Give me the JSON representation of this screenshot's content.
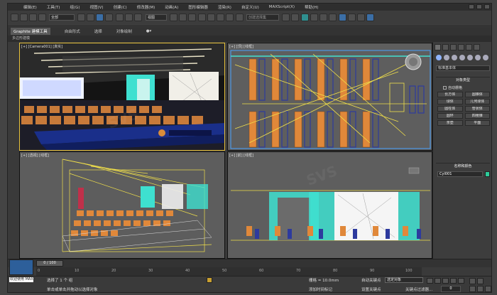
{
  "menu": {
    "items": [
      "编辑(E)",
      "工具(T)",
      "组(G)",
      "视图(V)",
      "创建(C)",
      "修改器(M)",
      "动画(A)",
      "图形编辑器",
      "渲染(R)",
      "自定义(U)",
      "MAXScript(X)",
      "帮助(H)"
    ]
  },
  "toolbar": {
    "selection_filter": "全部",
    "view_dropdown": "视图",
    "named_selection_placeholder": "创建选择集"
  },
  "ribbon": {
    "tabs": [
      "Graphite 建模工具",
      "自由形式",
      "选择",
      "对象绘制"
    ],
    "active_tab": "Graphite 建模工具",
    "panel_label": "多边形建模"
  },
  "viewports": {
    "top_left": "[+] [Camera001] [真实]",
    "top_right": "[+] [顶] [线框]",
    "bottom_left": "[+] [透视] [线框]",
    "bottom_right": "[+] [前] [线框]"
  },
  "command_panel": {
    "category": "标准基本体",
    "object_type_header": "对象类型",
    "autogrid_label": "自动栅格",
    "buttons": [
      "长方体",
      "圆锥体",
      "球体",
      "几何球体",
      "圆柱体",
      "管状体",
      "圆环",
      "四棱锥",
      "茶壶",
      "平面"
    ],
    "name_color_header": "名称和颜色",
    "object_name": "Cyl001",
    "object_color": "#2dcc9a"
  },
  "timeline": {
    "frame_display": "0 / 100",
    "ticks": [
      "0",
      "10",
      "20",
      "30",
      "40",
      "50",
      "60",
      "70",
      "80",
      "90",
      "100"
    ]
  },
  "status": {
    "maxscript_text": "欢迎使用 MAXSc",
    "line1": "选择了 1 个 组",
    "line2": "单击或单击并拖动以选择对象",
    "grid": "栅格 = 10.0mm",
    "add_time_tag": "添加时间标记",
    "auto_key": "自动关键点",
    "set_key": "设置关键点",
    "selection_set": "选定对象",
    "key_filters": "关键点过滤器...",
    "current_frame": "0"
  },
  "watermark": "SVS"
}
